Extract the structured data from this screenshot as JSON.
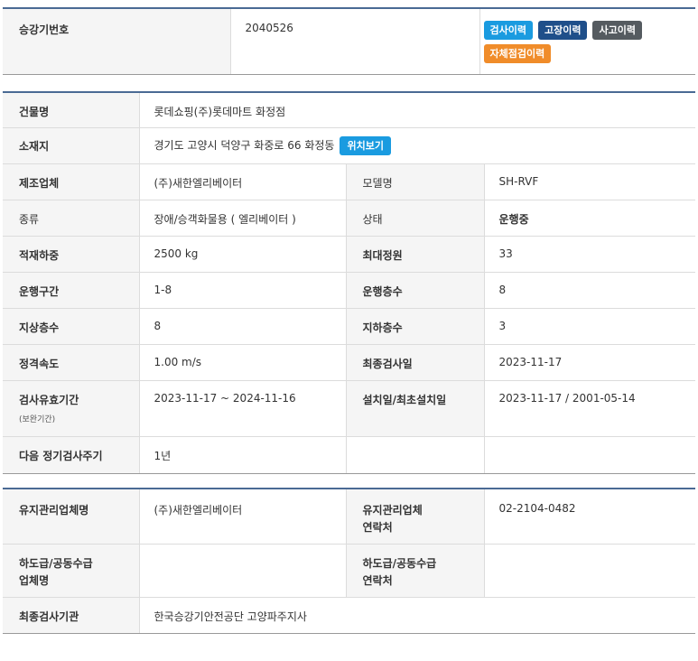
{
  "summary": {
    "elevator_no_label": "승강기번호",
    "elevator_no": "2040526",
    "buttons": {
      "inspection": "검사이력",
      "failure": "고장이력",
      "accident": "사고이력",
      "self_check": "자체점검이력"
    }
  },
  "details": {
    "building_label": "건물명",
    "building": "롯데쇼핑(주)롯데마트 화정점",
    "address_label": "소재지",
    "address": "경기도 고양시 덕양구 화중로 66 화정동",
    "location_button": "위치보기",
    "manufacturer_label": "제조업체",
    "manufacturer": "(주)새한엘리베이터",
    "model_label": "모델명",
    "model": "SH-RVF",
    "type_label": "종류",
    "type": "장애/승객화물용 ( 엘리베이터 )",
    "status_label": "상태",
    "status": "운행중",
    "load_label": "적재하중",
    "load": "2500 kg",
    "capacity_label": "최대정원",
    "capacity": "33",
    "section_label": "운행구간",
    "section": "1-8",
    "floors_label": "운행층수",
    "floors": "8",
    "above_label": "지상층수",
    "above": "8",
    "below_label": "지하층수",
    "below": "3",
    "speed_label": "정격속도",
    "speed": "1.00 m/s",
    "last_insp_label": "최종검사일",
    "last_insp": "2023-11-17",
    "valid_label": "검사유효기간",
    "valid_sub": "(보완기간)",
    "valid": "2023-11-17 ~ 2024-11-16",
    "install_label": "설치일/최초설치일",
    "install": "2023-11-17 / 2001-05-14",
    "cycle_label": "다음 정기검사주기",
    "cycle": "1년"
  },
  "maintenance": {
    "company_label": "유지관리업체명",
    "company": "(주)새한엘리베이터",
    "contact_label_1": "유지관리업체",
    "contact_label_2": "연락처",
    "contact": "02-2104-0482",
    "sub_label_1": "하도급/공동수급",
    "sub_label_2": "업체명",
    "sub_contact_label_1": "하도급/공동수급",
    "sub_contact_label_2": "연락처",
    "agency_label": "최종검사기관",
    "agency": "한국승강기안전공단 고양파주지사"
  }
}
